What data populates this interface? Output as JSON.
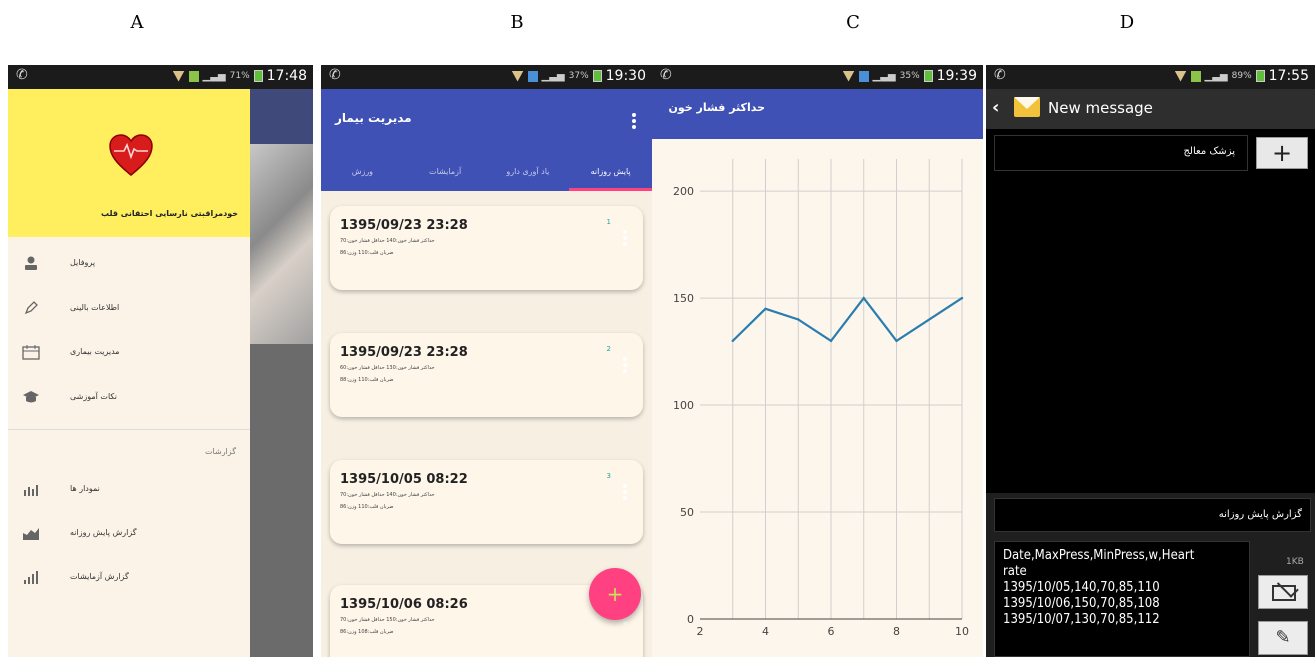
{
  "labels": [
    "A",
    "B",
    "C",
    "D"
  ],
  "panelA": {
    "status_time": "17:48",
    "status_battery": "71%",
    "drawer_title": "خودمراقبتی نارسایی احتقانی قلب",
    "items": [
      {
        "label": "پروفایل",
        "icon": "person-icon"
      },
      {
        "label": "اطلاعات بالینی",
        "icon": "pencil-icon"
      },
      {
        "label": "مدیریت بیماری",
        "icon": "calendar-icon"
      },
      {
        "label": "نکات آموزشی",
        "icon": "graduation-cap-icon"
      }
    ],
    "section_title": "گزارشات",
    "report_items": [
      {
        "label": "نمودار ها",
        "icon": "chart-icon"
      },
      {
        "label": "گزارش پایش روزانه",
        "icon": "area-chart-icon"
      },
      {
        "label": "گزارش آزمایشات",
        "icon": "bar-chart-icon"
      }
    ]
  },
  "panelB": {
    "status_time": "19:30",
    "status_battery": "37%",
    "title": "مدیریت بیمار",
    "tabs": [
      "پایش روزانه",
      "یاد آوری دارو",
      "آزمایشات",
      "ورزش"
    ],
    "cards": [
      {
        "date": "1395/09/23 23:28",
        "line1": "حداکثر فشار خون:140 حداقل فشار خون:70",
        "line2": "ضربان قلب:110 وزن:86",
        "num": "1"
      },
      {
        "date": "1395/09/23 23:28",
        "line1": "حداکثر فشار خون:130 حداقل فشار خون:60",
        "line2": "ضربان قلب:110 وزن:88",
        "num": "2"
      },
      {
        "date": "1395/10/05 08:22",
        "line1": "حداکثر فشار خون:140 حداقل فشار خون:70",
        "line2": "ضربان قلب:110 وزن:86",
        "num": "3"
      },
      {
        "date": "1395/10/06 08:26",
        "line1": "حداکثر فشار خون:150 حداقل فشار خون:70",
        "line2": "ضربان قلب:108 وزن:86",
        "num": ""
      }
    ],
    "fab_icon": "+"
  },
  "panelC": {
    "status_time": "19:39",
    "status_battery": "35%",
    "title": "حداکثر فشار خون"
  },
  "chart_data": {
    "type": "line",
    "title": "حداکثر فشار خون",
    "x": [
      3,
      4,
      5,
      6,
      7,
      8,
      10
    ],
    "series": [
      {
        "values": [
          130,
          145,
          140,
          130,
          150,
          130,
          150
        ]
      }
    ],
    "xlim": [
      2,
      10
    ],
    "ylim": [
      0,
      215
    ],
    "xticks": [
      2,
      4,
      6,
      8,
      10
    ],
    "yticks": [
      0,
      50,
      100,
      150,
      200
    ],
    "grid": true,
    "line_color": "#2a7db0"
  },
  "panelD": {
    "status_time": "17:55",
    "status_battery": "89%",
    "title": "New message",
    "recipient": "پزشک معالج",
    "subject": "گزارش پایش روزانه",
    "message_lines": [
      "Date,MaxPress,MinPress,w,Heart",
      "rate",
      "1395/10/05,140,70,85,110",
      "1395/10/06,150,70,85,108",
      "1395/10/07,130,70,85,112"
    ],
    "size": "1KB"
  }
}
